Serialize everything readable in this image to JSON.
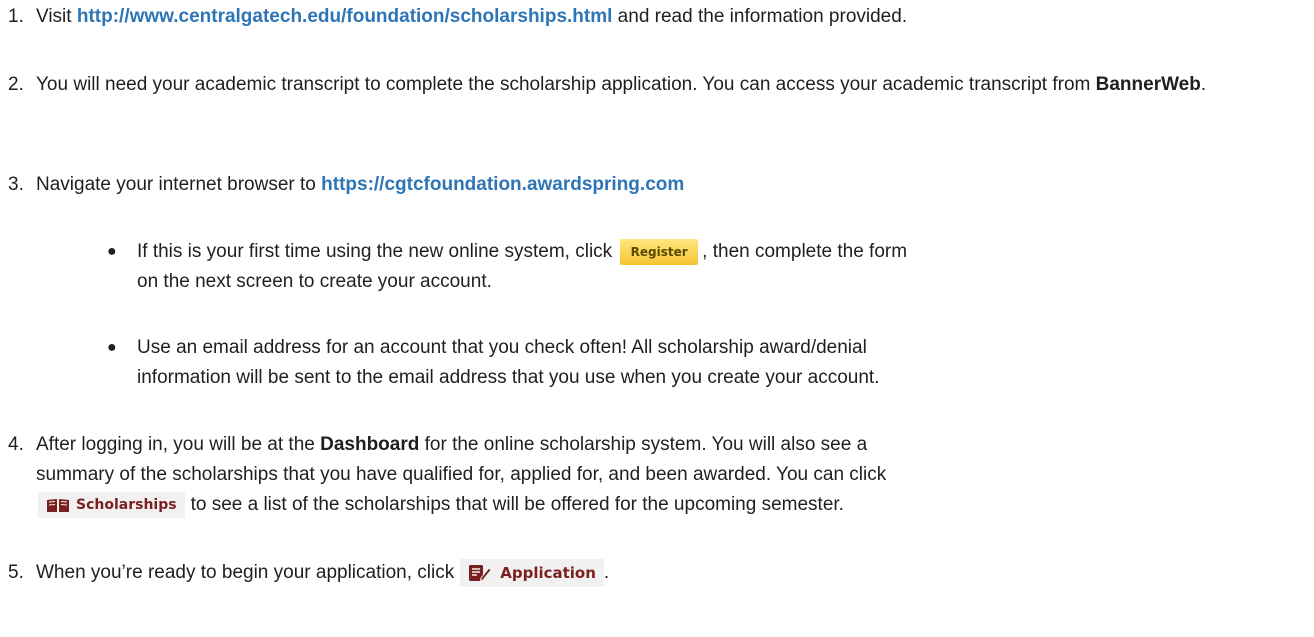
{
  "steps": [
    {
      "num": "1.",
      "pre": "Visit ",
      "link": "http://www.centralgatech.edu/foundation/scholarships.html",
      "post": " and read the information provided."
    },
    {
      "num": "2.",
      "pre": "You will need your academic transcript to complete the scholarship application. You can access your academic transcript from ",
      "bold": "BannerWeb",
      "post": "."
    },
    {
      "num": "3.",
      "pre": "Navigate your internet browser to ",
      "link": "https://cgtcfoundation.awardspring.com"
    },
    {
      "num": "4.",
      "pre": "After logging in, you will be at the ",
      "bold": "Dashboard",
      "post_line1": " for the online scholarship system. You will also see a",
      "line2": "summary of the scholarships that you have qualified for, applied for, and been awarded.  You can click",
      "line3_post": "to see a list of the scholarships that will be offered for the upcoming semester."
    },
    {
      "num": "5.",
      "pre": "When you’re ready to begin your application, click",
      "post": "."
    }
  ],
  "bullets": [
    {
      "pre": "If this is your first time using the new online system, click",
      "post_line1": ", then complete the form",
      "line2": "on the next screen to create your account."
    },
    {
      "line1": "Use an email address for an account that you check often!  All scholarship award/denial",
      "line2": "information will be sent to the email address that you use when you create your account."
    }
  ],
  "buttons": {
    "register": "Register",
    "scholarships": "Scholarships",
    "application": "Application"
  },
  "colors": {
    "link": "#2e75b6",
    "register_bg": "#f4c430",
    "button_text": "#7a1f1f"
  }
}
